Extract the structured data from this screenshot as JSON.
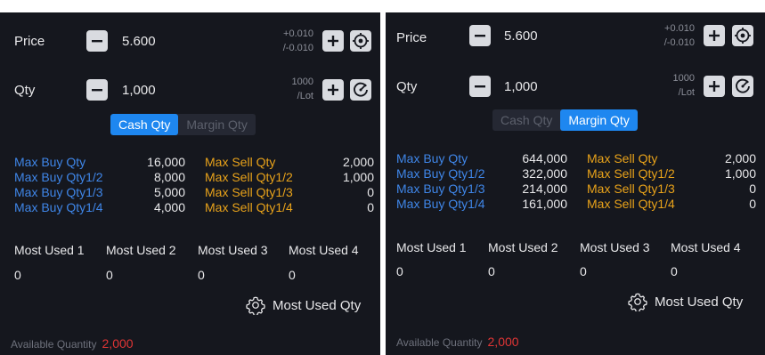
{
  "left": {
    "price_label": "Price",
    "price_value": "5.600",
    "price_step_up": "+0.010",
    "price_step_down": "/-0.010",
    "qty_label": "Qty",
    "qty_value": "1,000",
    "qty_step_top": "1000",
    "qty_step_bottom": "/Lot",
    "tabs": [
      {
        "label": "Cash Qty",
        "active": true
      },
      {
        "label": "Margin Qty",
        "active": false
      }
    ],
    "buy": [
      {
        "label": "Max Buy Qty",
        "value": "16,000"
      },
      {
        "label": "Max Buy Qty1/2",
        "value": "8,000"
      },
      {
        "label": "Max Buy Qty1/3",
        "value": "5,000"
      },
      {
        "label": "Max Buy Qty1/4",
        "value": "4,000"
      }
    ],
    "sell": [
      {
        "label": "Max Sell Qty",
        "value": "2,000"
      },
      {
        "label": "Max Sell Qty1/2",
        "value": "1,000"
      },
      {
        "label": "Max Sell Qty1/3",
        "value": "0"
      },
      {
        "label": "Max Sell Qty1/4",
        "value": "0"
      }
    ],
    "most_used": [
      {
        "label": "Most Used 1",
        "value": "0"
      },
      {
        "label": "Most Used 2",
        "value": "0"
      },
      {
        "label": "Most Used 3",
        "value": "0"
      },
      {
        "label": "Most Used 4",
        "value": "0"
      }
    ],
    "most_used_settings": "Most Used Qty",
    "available_label": "Available Quantity",
    "available_value": "2,000"
  },
  "right": {
    "price_label": "Price",
    "price_value": "5.600",
    "price_step_up": "+0.010",
    "price_step_down": "/-0.010",
    "qty_label": "Qty",
    "qty_value": "1,000",
    "qty_step_top": "1000",
    "qty_step_bottom": "/Lot",
    "tabs": [
      {
        "label": "Cash Qty",
        "active": false
      },
      {
        "label": "Margin Qty",
        "active": true
      }
    ],
    "buy": [
      {
        "label": "Max Buy Qty",
        "value": "644,000"
      },
      {
        "label": "Max Buy Qty1/2",
        "value": "322,000"
      },
      {
        "label": "Max Buy Qty1/3",
        "value": "214,000"
      },
      {
        "label": "Max Buy Qty1/4",
        "value": "161,000"
      }
    ],
    "sell": [
      {
        "label": "Max Sell Qty",
        "value": "2,000"
      },
      {
        "label": "Max Sell Qty1/2",
        "value": "1,000"
      },
      {
        "label": "Max Sell Qty1/3",
        "value": "0"
      },
      {
        "label": "Max Sell Qty1/4",
        "value": "0"
      }
    ],
    "most_used": [
      {
        "label": "Most Used 1",
        "value": "0"
      },
      {
        "label": "Most Used 2",
        "value": "0"
      },
      {
        "label": "Most Used 3",
        "value": "0"
      },
      {
        "label": "Most Used 4",
        "value": "0"
      }
    ],
    "most_used_settings": "Most Used Qty",
    "available_label": "Available Quantity",
    "available_value": "2,000"
  },
  "icons": {
    "minus": "minus-icon",
    "plus": "plus-icon",
    "target": "target-icon",
    "gauge": "gauge-icon",
    "gear": "gear-icon"
  },
  "colors": {
    "panel_bg": "#15171e",
    "buy_label": "#3f86e8",
    "sell_label": "#e8a21a",
    "tab_active": "#1e87f0",
    "available_value": "#e03535"
  }
}
